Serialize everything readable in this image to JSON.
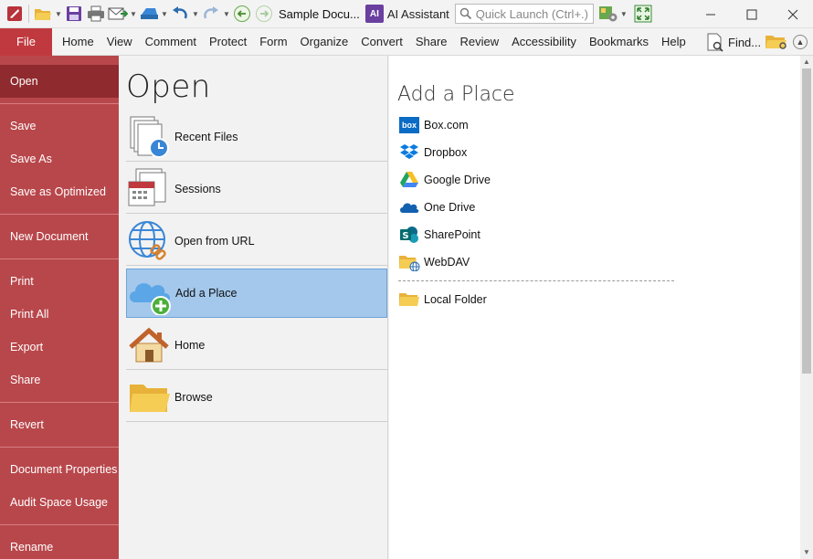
{
  "titlebar": {
    "document_title": "Sample Docu...",
    "ai_badge": "AI",
    "ai_label": "AI Assistant",
    "quick_launch_placeholder": "Quick Launch (Ctrl+.)"
  },
  "ribbon": {
    "file_label": "File",
    "tabs": [
      "Home",
      "View",
      "Comment",
      "Protect",
      "Form",
      "Organize",
      "Convert",
      "Share",
      "Review",
      "Accessibility",
      "Bookmarks",
      "Help"
    ],
    "find_label": "Find..."
  },
  "backstage_menu": {
    "items": [
      "Open",
      "Save",
      "Save As",
      "Save as Optimized",
      "New Document",
      "Print",
      "Print All",
      "Export",
      "Share",
      "Revert",
      "Document Properties",
      "Audit Space Usage",
      "Rename"
    ],
    "active": "Open"
  },
  "open_panel": {
    "title": "Open",
    "items": [
      "Recent Files",
      "Sessions",
      "Open from URL",
      "Add a Place",
      "Home",
      "Browse"
    ],
    "selected": "Add a Place"
  },
  "add_place_panel": {
    "title": "Add a Place",
    "places": [
      "Box.com",
      "Dropbox",
      "Google Drive",
      "One Drive",
      "SharePoint",
      "WebDAV"
    ],
    "local": "Local Folder",
    "box_icon_text": "box"
  },
  "colors": {
    "file_tab": "#c0393f",
    "menu_bg": "#b8474b",
    "menu_active": "#8f2a2e",
    "selection": "#a3c8ec"
  }
}
